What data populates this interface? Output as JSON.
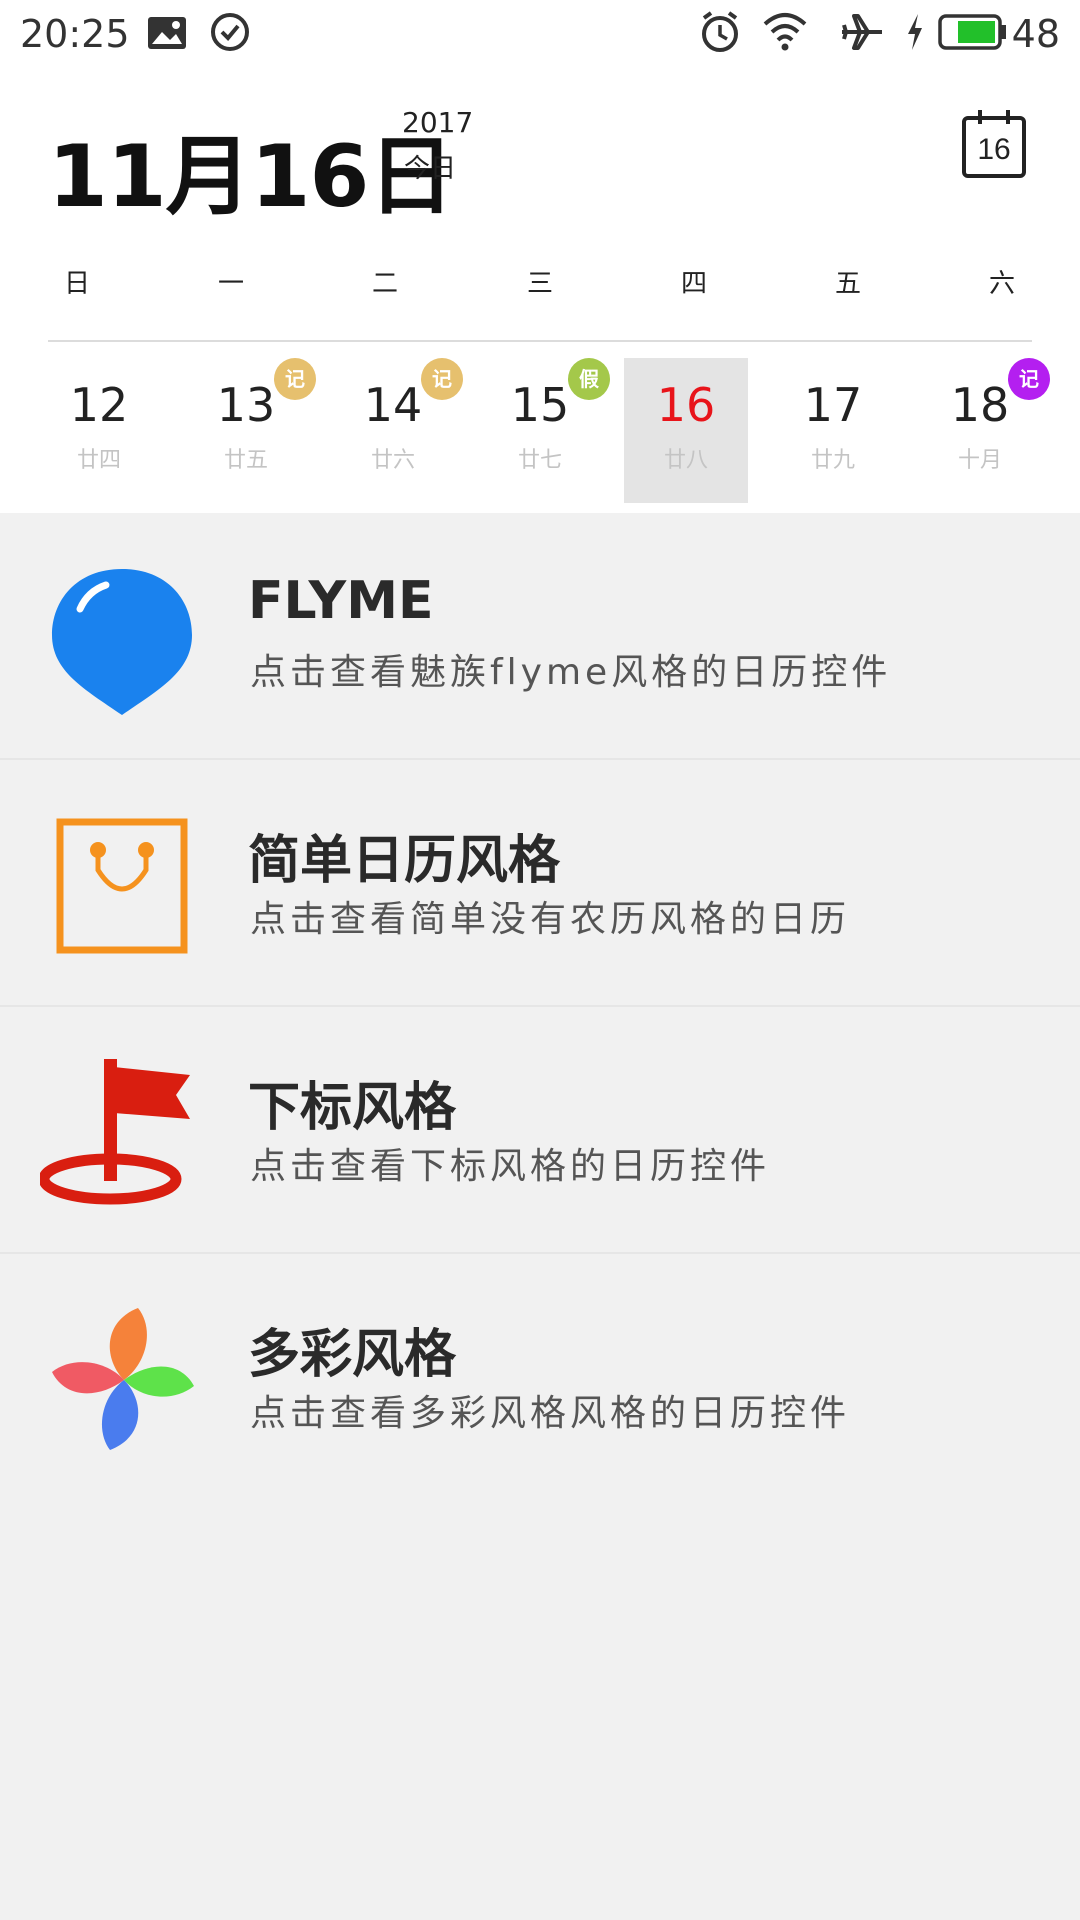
{
  "status_bar": {
    "time": "20:25",
    "battery": "48",
    "icons": [
      "image-icon",
      "check-circle-icon",
      "alarm-icon",
      "wifi-icon",
      "airplane-icon",
      "charging-icon",
      "battery-icon"
    ],
    "battery_color": "#22c02a"
  },
  "header": {
    "date": "11月16日",
    "year": "2017",
    "today_label": "今日",
    "calendar_button_day": "16"
  },
  "calendar": {
    "weekdays": [
      "日",
      "一",
      "二",
      "三",
      "四",
      "五",
      "六"
    ],
    "days": [
      {
        "num": "12",
        "lunar": "廿四",
        "badge": ""
      },
      {
        "num": "13",
        "lunar": "廿五",
        "badge": "记"
      },
      {
        "num": "14",
        "lunar": "廿六",
        "badge": "记"
      },
      {
        "num": "15",
        "lunar": "廿七",
        "badge": "假"
      },
      {
        "num": "16",
        "lunar": "廿八",
        "badge": ""
      },
      {
        "num": "17",
        "lunar": "廿九",
        "badge": ""
      },
      {
        "num": "18",
        "lunar": "十月",
        "badge": "记"
      }
    ],
    "selected_day": "16",
    "colors": {
      "selected_text": "#e8141a",
      "badge_note": "#e6c06e",
      "badge_holiday": "#a4c84a",
      "badge_note_purple": "#b41ff0"
    }
  },
  "list": {
    "items": [
      {
        "title": "FLYME",
        "subtitle": "点击查看魅族flyme风格的日历控件",
        "icon": "blue-balloon-icon"
      },
      {
        "title": "简单日历风格",
        "subtitle": "点击查看简单没有农历风格的日历",
        "icon": "shopping-bag-icon"
      },
      {
        "title": "下标风格",
        "subtitle": "点击查看下标风格的日历控件",
        "icon": "flag-icon"
      },
      {
        "title": "多彩风格",
        "subtitle": "点击查看多彩风格风格的日历控件",
        "icon": "pinwheel-icon"
      }
    ]
  }
}
